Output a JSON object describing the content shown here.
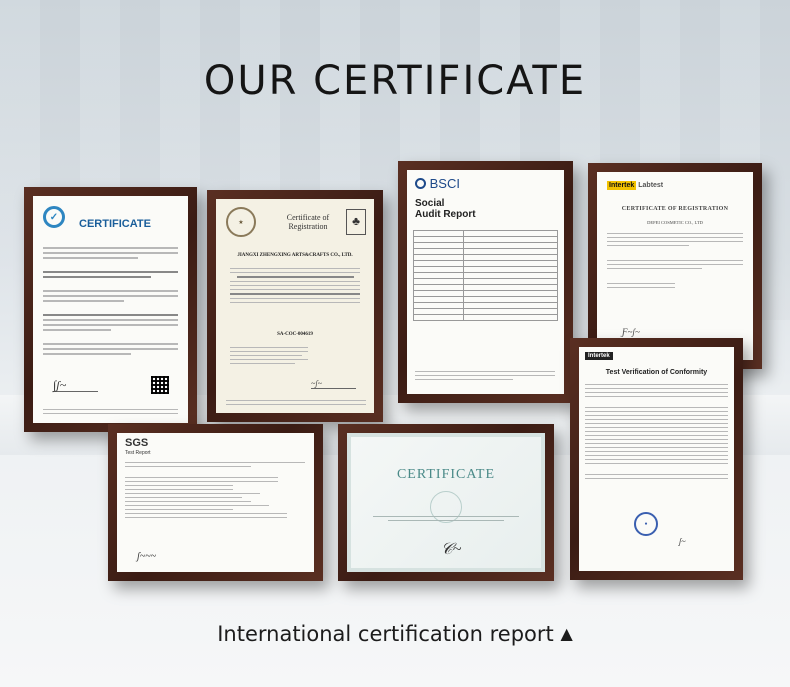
{
  "header": {
    "title": "OUR CERTIFICATE"
  },
  "certificates": {
    "fsc": {
      "title": "CERTIFICATE"
    },
    "fsc_registration": {
      "title_line1": "Certificate of",
      "title_line2": "Registration",
      "company": "JIANGXI ZHENGXING ARTS&CRAFTS CO., LTD.",
      "code": "SA-COC-004619"
    },
    "bsci": {
      "logo": "BSCI",
      "title_line1": "Social",
      "title_line2": "Audit Report"
    },
    "intertek_labtest": {
      "brand": "Intertek",
      "brand2": "Labtest",
      "title": "CERTIFICATE OF REGISTRATION",
      "company": "DEFEI COSMETIC CO., LTD"
    },
    "intertek_verification": {
      "brand": "Intertek",
      "title": "Test Verification of Conformity"
    },
    "sgs": {
      "brand": "SGS",
      "subtitle": "Test Report"
    },
    "generic": {
      "title": "CERTIFICATE"
    }
  },
  "footer": {
    "caption": "International certification report",
    "arrow": "▲"
  },
  "colors": {
    "frame": "#4a2419",
    "fsc_blue": "#1a5e9a",
    "bsci_blue": "#1e4a8a",
    "intertek_yellow": "#f2c200"
  }
}
